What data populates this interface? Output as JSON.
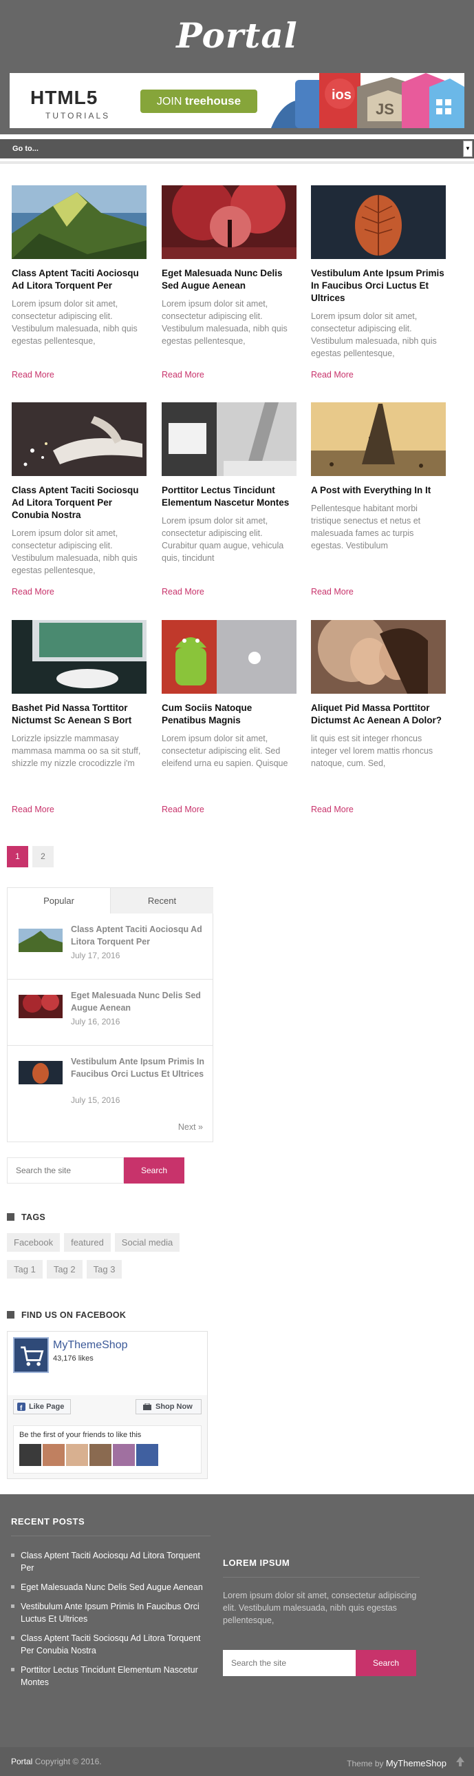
{
  "site": {
    "logo_text": "Portal"
  },
  "banner": {
    "html5": "HTML5",
    "tutorials": "TUTORIALS",
    "join_prefix": "JOIN ",
    "join_brand": "treehouse",
    "tile_ios": "ios",
    "tile_js": "JS"
  },
  "nav": {
    "select_label": "Go to..."
  },
  "posts": [
    {
      "title": "Class Aptent Taciti Aociosqu Ad Litora Torquent Per",
      "excerpt": "Lorem ipsum dolor sit amet, consectetur adipiscing elit. Vestibulum malesuada, nibh quis egestas pellentesque,",
      "read_more": "Read More"
    },
    {
      "title": "Eget Malesuada Nunc Delis Sed Augue Aenean",
      "excerpt": "Lorem ipsum dolor sit amet, consectetur adipiscing elit. Vestibulum malesuada, nibh quis egestas pellentesque,",
      "read_more": "Read More"
    },
    {
      "title": "Vestibulum Ante Ipsum Primis In Faucibus Orci Luctus Et Ultrices",
      "excerpt": "Lorem ipsum dolor sit amet, consectetur adipiscing elit. Vestibulum malesuada, nibh quis egestas pellentesque,",
      "read_more": "Read More"
    },
    {
      "title": "Class Aptent Taciti Sociosqu Ad Litora Torquent Per Conubia Nostra",
      "excerpt": "Lorem ipsum dolor sit amet, consectetur adipiscing elit. Vestibulum malesuada, nibh quis egestas pellentesque,",
      "read_more": "Read More"
    },
    {
      "title": "Porttitor Lectus Tincidunt Elementum Nascetur Montes",
      "excerpt": "Lorem ipsum dolor sit amet, consectetur adipiscing elit. Curabitur quam augue, vehicula quis, tincidunt",
      "read_more": "Read More"
    },
    {
      "title": "A Post with Everything In It",
      "excerpt": "Pellentesque habitant morbi tristique senectus et netus et malesuada fames ac turpis egestas. Vestibulum",
      "read_more": "Read More"
    },
    {
      "title": "Bashet Pid Nassa Torttitor Nictumst Sc Aenean S Bort",
      "excerpt": "Lorizzle ipsizzle mammasay mammasa mamma oo sa sit stuff, shizzle my nizzle crocodizzle i'm",
      "read_more": "Read More"
    },
    {
      "title": "Cum Sociis Natoque Penatibus Magnis",
      "excerpt": "Lorem ipsum dolor sit amet, consectetur adipiscing elit. Sed eleifend urna eu sapien. Quisque",
      "read_more": "Read More"
    },
    {
      "title": "Aliquet Pid Massa Porttitor Dictumst Ac Aenean A Dolor?",
      "excerpt": "lit quis est sit integer rhoncus integer vel lorem mattis rhoncus natoque, cum. Sed,",
      "read_more": "Read More"
    }
  ],
  "pagination": {
    "pages": [
      "1",
      "2"
    ],
    "current": "1"
  },
  "tabs_widget": {
    "tabs": [
      "Popular",
      "Recent"
    ],
    "items": [
      {
        "title": "Class Aptent Taciti Aociosqu Ad Litora Torquent Per",
        "date": "July 17, 2016"
      },
      {
        "title": "Eget Malesuada Nunc Delis Sed Augue Aenean",
        "date": "July 16, 2016"
      },
      {
        "title": "Vestibulum Ante Ipsum Primis In Faucibus Orci Luctus Et Ultrices",
        "date": "July 15, 2016"
      }
    ],
    "next_label": "Next »"
  },
  "search": {
    "placeholder": "Search the site",
    "button": "Search"
  },
  "tags_widget": {
    "heading": "TAGS",
    "tags": [
      "Facebook",
      "featured",
      "Social media",
      "Tag 1",
      "Tag 2",
      "Tag 3"
    ]
  },
  "facebook_widget": {
    "heading": "FIND US ON FACEBOOK",
    "page_name": "MyThemeShop",
    "likes": "43,176 likes",
    "like_button": "Like Page",
    "shop_button": "Shop Now",
    "friends_text": "Be the first of your friends to like this"
  },
  "footer": {
    "recent_heading": "RECENT POSTS",
    "recent_posts": [
      "Class Aptent Taciti Aociosqu Ad Litora Torquent Per",
      "Eget Malesuada Nunc Delis Sed Augue Aenean",
      "Vestibulum Ante Ipsum Primis In Faucibus Orci Luctus Et Ultrices",
      "Class Aptent Taciti Sociosqu Ad Litora Torquent Per Conubia Nostra",
      "Porttitor Lectus Tincidunt Elementum Nascetur Montes"
    ],
    "lorem_heading": "LOREM IPSUM",
    "lorem_text": "Lorem ipsum dolor sit amet, consectetur adipiscing elit. Vestibulum malesuada, nibh quis egestas pellentesque,",
    "search_placeholder": "Search the site",
    "search_button": "Search"
  },
  "bottom_bar": {
    "site_name": "Portal",
    "copyright": " Copyright © 2016.",
    "theme_by": "Theme by ",
    "theme_name": "MyThemeShop"
  },
  "colors": {
    "accent": "#c8336b",
    "header_bg": "#676767",
    "footer_bg": "#666666",
    "facebook_blue": "#3b5998"
  }
}
